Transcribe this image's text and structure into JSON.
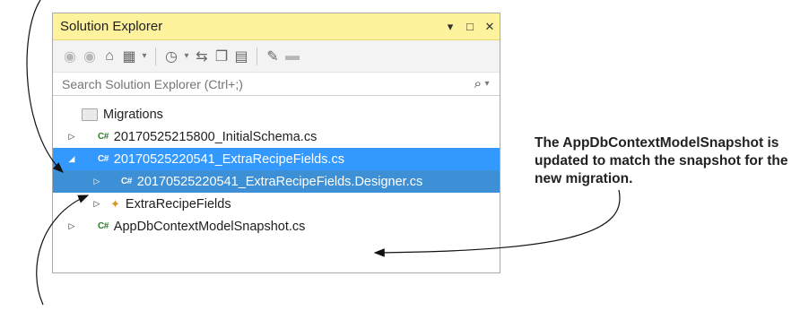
{
  "panel": {
    "title": "Solution Explorer",
    "controls": {
      "dropdown": "▾",
      "maximize": "□",
      "close": "✕"
    },
    "toolbar_icons": [
      "back-icon",
      "forward-icon",
      "home-icon",
      "sync-icon",
      "history-icon",
      "sync-with-active-icon",
      "collapse-all-icon",
      "show-all-files-icon",
      "properties-icon",
      "preview-icon"
    ],
    "search": {
      "placeholder": "Search Solution Explorer (Ctrl+;)",
      "icon": "⌕"
    }
  },
  "tree": {
    "items": [
      {
        "label": "Migrations",
        "icon": "folder-icon"
      },
      {
        "label": "20170525215800_InitialSchema.cs",
        "icon": "csharp-file-icon",
        "badge": "C#"
      },
      {
        "label": "20170525220541_ExtraRecipeFields.cs",
        "icon": "csharp-file-icon",
        "badge": "C#"
      },
      {
        "label": "20170525220541_ExtraRecipeFields.Designer.cs",
        "icon": "csharp-file-icon",
        "badge": "C#"
      },
      {
        "label": "ExtraRecipeFields",
        "icon": "class-icon"
      },
      {
        "label": "AppDbContextModelSnapshot.cs",
        "icon": "csharp-file-icon",
        "badge": "C#"
      }
    ]
  },
  "callout": {
    "text": "The AppDbContextModelSnapshot is updated to match the snapshot for the new migration."
  }
}
